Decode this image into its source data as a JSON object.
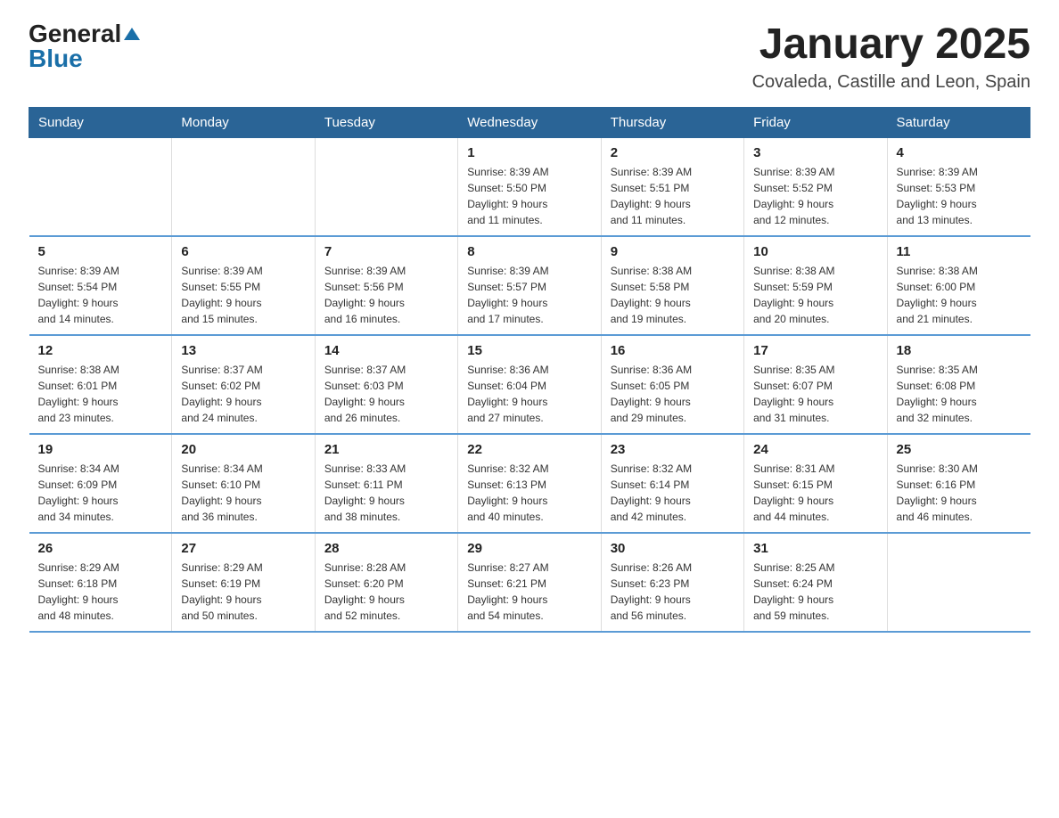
{
  "logo": {
    "general": "General",
    "blue": "Blue"
  },
  "title": "January 2025",
  "location": "Covaleda, Castille and Leon, Spain",
  "headers": [
    "Sunday",
    "Monday",
    "Tuesday",
    "Wednesday",
    "Thursday",
    "Friday",
    "Saturday"
  ],
  "weeks": [
    [
      {
        "day": "",
        "info": ""
      },
      {
        "day": "",
        "info": ""
      },
      {
        "day": "",
        "info": ""
      },
      {
        "day": "1",
        "info": "Sunrise: 8:39 AM\nSunset: 5:50 PM\nDaylight: 9 hours\nand 11 minutes."
      },
      {
        "day": "2",
        "info": "Sunrise: 8:39 AM\nSunset: 5:51 PM\nDaylight: 9 hours\nand 11 minutes."
      },
      {
        "day": "3",
        "info": "Sunrise: 8:39 AM\nSunset: 5:52 PM\nDaylight: 9 hours\nand 12 minutes."
      },
      {
        "day": "4",
        "info": "Sunrise: 8:39 AM\nSunset: 5:53 PM\nDaylight: 9 hours\nand 13 minutes."
      }
    ],
    [
      {
        "day": "5",
        "info": "Sunrise: 8:39 AM\nSunset: 5:54 PM\nDaylight: 9 hours\nand 14 minutes."
      },
      {
        "day": "6",
        "info": "Sunrise: 8:39 AM\nSunset: 5:55 PM\nDaylight: 9 hours\nand 15 minutes."
      },
      {
        "day": "7",
        "info": "Sunrise: 8:39 AM\nSunset: 5:56 PM\nDaylight: 9 hours\nand 16 minutes."
      },
      {
        "day": "8",
        "info": "Sunrise: 8:39 AM\nSunset: 5:57 PM\nDaylight: 9 hours\nand 17 minutes."
      },
      {
        "day": "9",
        "info": "Sunrise: 8:38 AM\nSunset: 5:58 PM\nDaylight: 9 hours\nand 19 minutes."
      },
      {
        "day": "10",
        "info": "Sunrise: 8:38 AM\nSunset: 5:59 PM\nDaylight: 9 hours\nand 20 minutes."
      },
      {
        "day": "11",
        "info": "Sunrise: 8:38 AM\nSunset: 6:00 PM\nDaylight: 9 hours\nand 21 minutes."
      }
    ],
    [
      {
        "day": "12",
        "info": "Sunrise: 8:38 AM\nSunset: 6:01 PM\nDaylight: 9 hours\nand 23 minutes."
      },
      {
        "day": "13",
        "info": "Sunrise: 8:37 AM\nSunset: 6:02 PM\nDaylight: 9 hours\nand 24 minutes."
      },
      {
        "day": "14",
        "info": "Sunrise: 8:37 AM\nSunset: 6:03 PM\nDaylight: 9 hours\nand 26 minutes."
      },
      {
        "day": "15",
        "info": "Sunrise: 8:36 AM\nSunset: 6:04 PM\nDaylight: 9 hours\nand 27 minutes."
      },
      {
        "day": "16",
        "info": "Sunrise: 8:36 AM\nSunset: 6:05 PM\nDaylight: 9 hours\nand 29 minutes."
      },
      {
        "day": "17",
        "info": "Sunrise: 8:35 AM\nSunset: 6:07 PM\nDaylight: 9 hours\nand 31 minutes."
      },
      {
        "day": "18",
        "info": "Sunrise: 8:35 AM\nSunset: 6:08 PM\nDaylight: 9 hours\nand 32 minutes."
      }
    ],
    [
      {
        "day": "19",
        "info": "Sunrise: 8:34 AM\nSunset: 6:09 PM\nDaylight: 9 hours\nand 34 minutes."
      },
      {
        "day": "20",
        "info": "Sunrise: 8:34 AM\nSunset: 6:10 PM\nDaylight: 9 hours\nand 36 minutes."
      },
      {
        "day": "21",
        "info": "Sunrise: 8:33 AM\nSunset: 6:11 PM\nDaylight: 9 hours\nand 38 minutes."
      },
      {
        "day": "22",
        "info": "Sunrise: 8:32 AM\nSunset: 6:13 PM\nDaylight: 9 hours\nand 40 minutes."
      },
      {
        "day": "23",
        "info": "Sunrise: 8:32 AM\nSunset: 6:14 PM\nDaylight: 9 hours\nand 42 minutes."
      },
      {
        "day": "24",
        "info": "Sunrise: 8:31 AM\nSunset: 6:15 PM\nDaylight: 9 hours\nand 44 minutes."
      },
      {
        "day": "25",
        "info": "Sunrise: 8:30 AM\nSunset: 6:16 PM\nDaylight: 9 hours\nand 46 minutes."
      }
    ],
    [
      {
        "day": "26",
        "info": "Sunrise: 8:29 AM\nSunset: 6:18 PM\nDaylight: 9 hours\nand 48 minutes."
      },
      {
        "day": "27",
        "info": "Sunrise: 8:29 AM\nSunset: 6:19 PM\nDaylight: 9 hours\nand 50 minutes."
      },
      {
        "day": "28",
        "info": "Sunrise: 8:28 AM\nSunset: 6:20 PM\nDaylight: 9 hours\nand 52 minutes."
      },
      {
        "day": "29",
        "info": "Sunrise: 8:27 AM\nSunset: 6:21 PM\nDaylight: 9 hours\nand 54 minutes."
      },
      {
        "day": "30",
        "info": "Sunrise: 8:26 AM\nSunset: 6:23 PM\nDaylight: 9 hours\nand 56 minutes."
      },
      {
        "day": "31",
        "info": "Sunrise: 8:25 AM\nSunset: 6:24 PM\nDaylight: 9 hours\nand 59 minutes."
      },
      {
        "day": "",
        "info": ""
      }
    ]
  ]
}
